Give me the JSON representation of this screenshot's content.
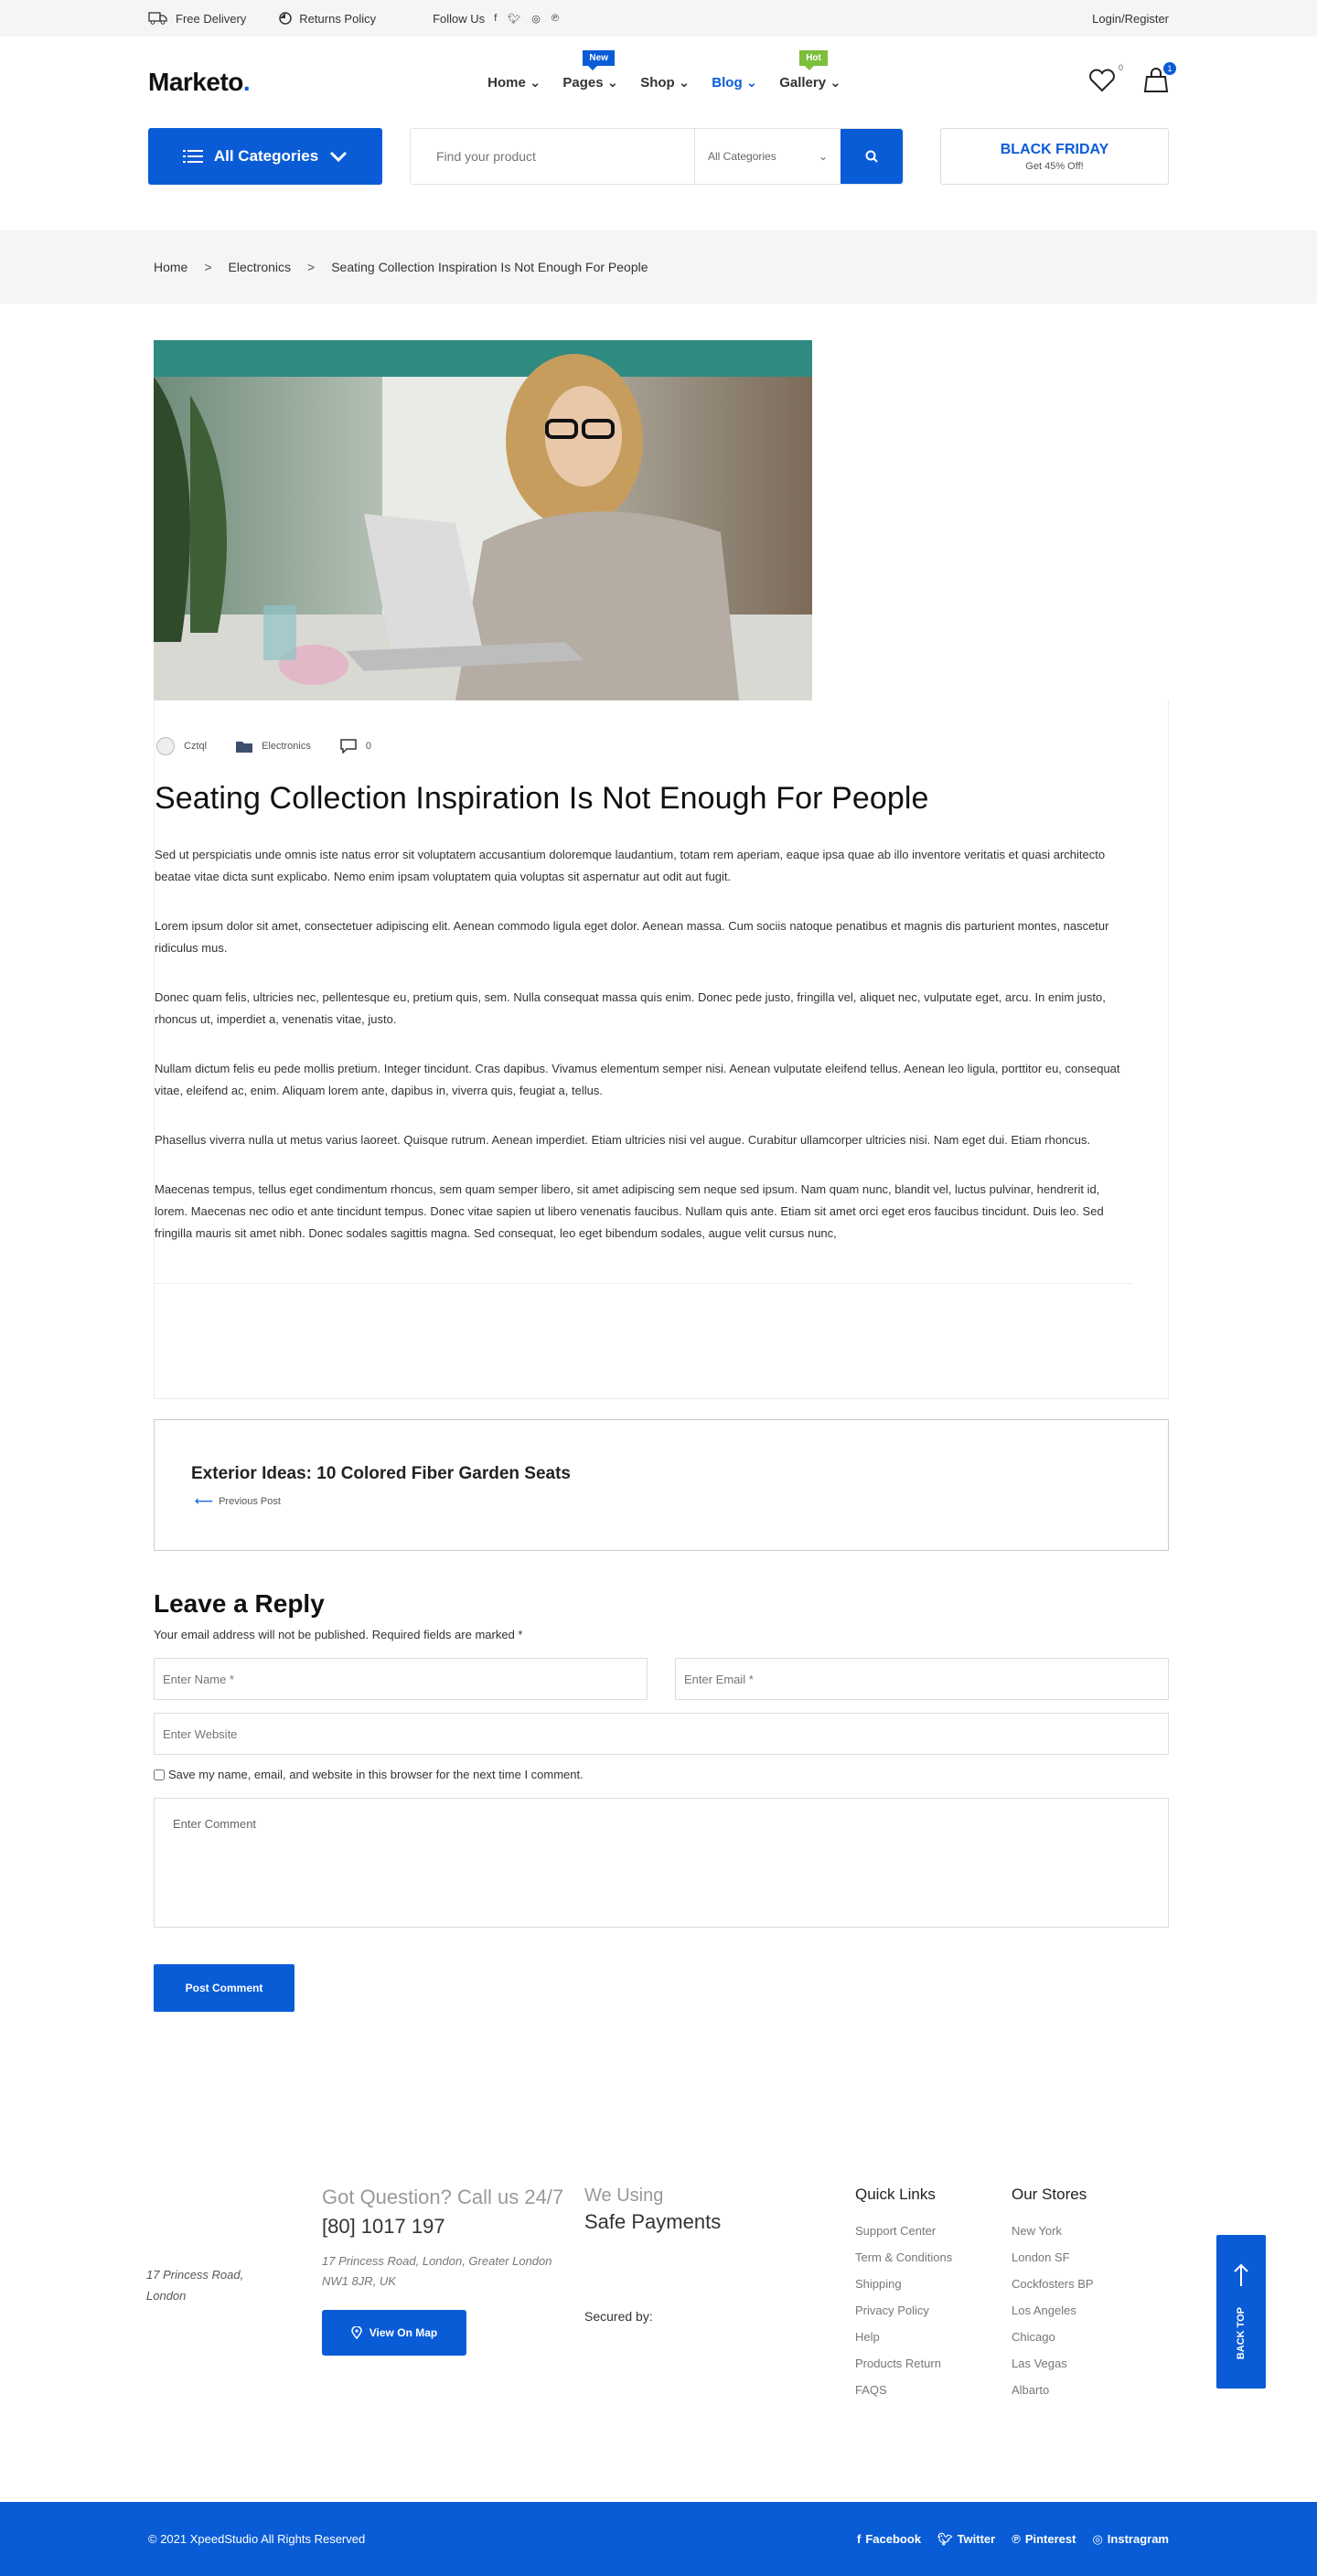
{
  "topbar": {
    "delivery": "Free Delivery",
    "returns": "Returns Policy",
    "follow": "Follow Us",
    "social_icons": [
      "facebook-icon",
      "twitter-icon",
      "instagram-icon",
      "pinterest-icon"
    ],
    "login": "Login/Register"
  },
  "header": {
    "logo": "Marketo",
    "logo_dot": ".",
    "nav": [
      {
        "label": "Home",
        "badge": ""
      },
      {
        "label": "Pages",
        "badge": "New"
      },
      {
        "label": "Shop",
        "badge": ""
      },
      {
        "label": "Blog",
        "badge": ""
      },
      {
        "label": "Gallery",
        "badge": "Hot"
      }
    ],
    "wishlist_count": "0",
    "cart_count": "1"
  },
  "search": {
    "categories_btn": "All Categories",
    "placeholder": "Find your product",
    "select_value": "All Categories",
    "promo_title": "BLACK FRIDAY",
    "promo_sub": "Get 45% Off!"
  },
  "breadcrumb": [
    "Home",
    "Electronics",
    "Seating Collection Inspiration Is Not Enough For People"
  ],
  "breadcrumb_sep": ">",
  "post": {
    "author": "Cztql",
    "category": "Electronics",
    "comments": "0",
    "title": "Seating Collection Inspiration Is Not Enough For People",
    "paragraphs": [
      "Sed ut perspiciatis unde omnis iste natus error sit voluptatem accusantium doloremque laudantium, totam rem aperiam, eaque ipsa quae ab illo inventore veritatis et quasi architecto beatae vitae dicta sunt explicabo. Nemo enim ipsam voluptatem quia voluptas sit aspernatur aut odit aut fugit.",
      "Lorem ipsum dolor sit amet, consectetuer adipiscing elit. Aenean commodo ligula eget dolor. Aenean massa. Cum sociis natoque penatibus et magnis dis parturient montes, nascetur ridiculus mus.",
      "Donec quam felis, ultricies nec, pellentesque eu, pretium quis, sem. Nulla consequat massa quis enim. Donec pede justo, fringilla vel, aliquet nec, vulputate eget, arcu. In enim justo, rhoncus ut, imperdiet a, venenatis vitae, justo.",
      "Nullam dictum felis eu pede mollis pretium. Integer tincidunt. Cras dapibus. Vivamus elementum semper nisi. Aenean vulputate eleifend tellus. Aenean leo ligula, porttitor eu, consequat vitae, eleifend ac, enim. Aliquam lorem ante, dapibus in, viverra quis, feugiat a, tellus.",
      "Phasellus viverra nulla ut metus varius laoreet. Quisque rutrum. Aenean imperdiet. Etiam ultricies nisi vel augue. Curabitur ullamcorper ultricies nisi. Nam eget dui. Etiam rhoncus.",
      "Maecenas tempus, tellus eget condimentum rhoncus, sem quam semper libero, sit amet adipiscing sem neque sed ipsum. Nam quam nunc, blandit vel, luctus pulvinar, hendrerit id, lorem. Maecenas nec odio et ante tincidunt tempus. Donec vitae sapien ut libero venenatis faucibus. Nullam quis ante. Etiam sit amet orci eget eros faucibus tincidunt. Duis leo. Sed fringilla mauris sit amet nibh. Donec sodales sagittis magna. Sed consequat, leo eget bibendum sodales, augue velit cursus nunc,"
    ]
  },
  "prev_post": {
    "title": "Exterior Ideas: 10 Colored Fiber Garden Seats",
    "label": "Previous Post"
  },
  "reply": {
    "title": "Leave a Reply",
    "note": "Your email address will not be published. Required fields are marked *",
    "name_ph": "Enter Name *",
    "email_ph": "Enter Email *",
    "website_ph": "Enter Website",
    "save_label": "Save my name, email, and website in this browser for the next time I comment.",
    "comment_ph": "Enter Comment",
    "submit": "Post Comment"
  },
  "footer": {
    "address_left": "17 Princess Road, London",
    "question": "Got Question? Call us 24/7",
    "phone": "[80] 1017 197",
    "address": "17 Princess Road, London, Greater London NW1 8JR, UK",
    "map_btn": "View On Map",
    "we_using": "We Using",
    "safe_payments": "Safe Payments",
    "secured_by": "Secured by:",
    "quick_links_title": "Quick Links",
    "quick_links": [
      "Support Center",
      "Term & Conditions",
      "Shipping",
      "Privacy Policy",
      "Help",
      "Products Return",
      "FAQS"
    ],
    "stores_title": "Our Stores",
    "stores": [
      "New York",
      "London SF",
      "Cockfosters BP",
      "Los Angeles",
      "Chicago",
      "Las Vegas",
      "Albarto"
    ],
    "back_top": "BACK TOP",
    "copyright": "© 2021 XpeedStudio All Rights Reserved",
    "social": [
      "Facebook",
      "Twitter",
      "Pinterest",
      "Instragram"
    ]
  },
  "colors": {
    "accent": "#0a5cd6",
    "hot": "#7bbf3b",
    "topbar_bg": "#f5f5f5"
  }
}
